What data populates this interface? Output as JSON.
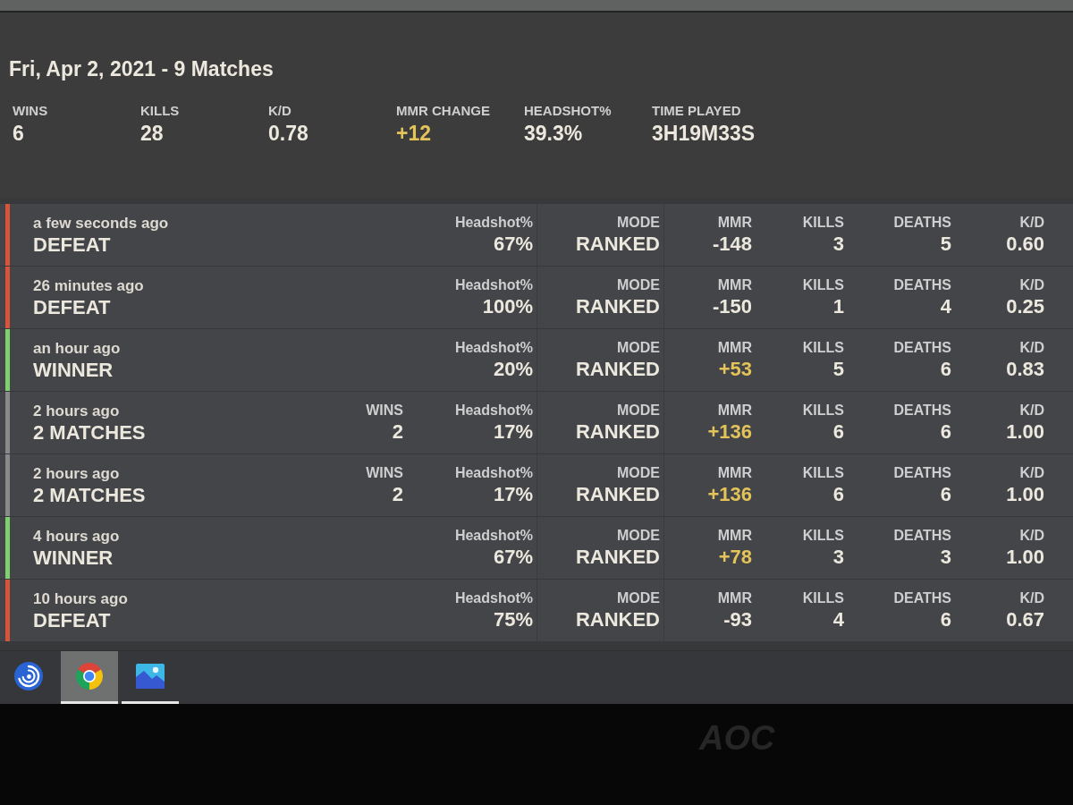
{
  "summary": {
    "title": "Fri, Apr 2, 2021 - 9 Matches",
    "stats": [
      {
        "label": "WINS",
        "value": "6",
        "highlight": false
      },
      {
        "label": "KILLS",
        "value": "28",
        "highlight": false
      },
      {
        "label": "K/D",
        "value": "0.78",
        "highlight": false
      },
      {
        "label": "MMR CHANGE",
        "value": "+12",
        "highlight": true
      },
      {
        "label": "HEADSHOT%",
        "value": "39.3%",
        "highlight": false
      },
      {
        "label": "TIME PLAYED",
        "value": "3H19M33S",
        "highlight": false
      }
    ]
  },
  "matches": [
    {
      "time": "a few seconds ago",
      "result": "DEFEAT",
      "color": "#d9533b",
      "stats": [
        {
          "label": "Headshot%",
          "value": "67%",
          "highlight": false
        },
        {
          "label": "MODE",
          "value": "RANKED",
          "highlight": false
        },
        {
          "label": "MMR",
          "value": "-148",
          "highlight": false
        },
        {
          "label": "KILLS",
          "value": "3",
          "highlight": false
        },
        {
          "label": "DEATHS",
          "value": "5",
          "highlight": false
        },
        {
          "label": "K/D",
          "value": "0.60",
          "highlight": false
        }
      ]
    },
    {
      "time": "26 minutes ago",
      "result": "DEFEAT",
      "color": "#d9533b",
      "stats": [
        {
          "label": "Headshot%",
          "value": "100%",
          "highlight": false
        },
        {
          "label": "MODE",
          "value": "RANKED",
          "highlight": false
        },
        {
          "label": "MMR",
          "value": "-150",
          "highlight": false
        },
        {
          "label": "KILLS",
          "value": "1",
          "highlight": false
        },
        {
          "label": "DEATHS",
          "value": "4",
          "highlight": false
        },
        {
          "label": "K/D",
          "value": "0.25",
          "highlight": false
        }
      ]
    },
    {
      "time": "an hour ago",
      "result": "WINNER",
      "color": "#7fd06e",
      "stats": [
        {
          "label": "Headshot%",
          "value": "20%",
          "highlight": false
        },
        {
          "label": "MODE",
          "value": "RANKED",
          "highlight": false
        },
        {
          "label": "MMR",
          "value": "+53",
          "highlight": true
        },
        {
          "label": "KILLS",
          "value": "5",
          "highlight": false
        },
        {
          "label": "DEATHS",
          "value": "6",
          "highlight": false
        },
        {
          "label": "K/D",
          "value": "0.83",
          "highlight": false
        }
      ]
    },
    {
      "time": "2 hours ago",
      "result": "2 MATCHES",
      "color": "#8a8a8a",
      "wins": {
        "label": "WINS",
        "value": "2"
      },
      "stats": [
        {
          "label": "Headshot%",
          "value": "17%",
          "highlight": false
        },
        {
          "label": "MODE",
          "value": "RANKED",
          "highlight": false
        },
        {
          "label": "MMR",
          "value": "+136",
          "highlight": true
        },
        {
          "label": "KILLS",
          "value": "6",
          "highlight": false
        },
        {
          "label": "DEATHS",
          "value": "6",
          "highlight": false
        },
        {
          "label": "K/D",
          "value": "1.00",
          "highlight": false
        }
      ]
    },
    {
      "time": "2 hours ago",
      "result": "2 MATCHES",
      "color": "#8a8a8a",
      "wins": {
        "label": "WINS",
        "value": "2"
      },
      "stats": [
        {
          "label": "Headshot%",
          "value": "17%",
          "highlight": false
        },
        {
          "label": "MODE",
          "value": "RANKED",
          "highlight": false
        },
        {
          "label": "MMR",
          "value": "+136",
          "highlight": true
        },
        {
          "label": "KILLS",
          "value": "6",
          "highlight": false
        },
        {
          "label": "DEATHS",
          "value": "6",
          "highlight": false
        },
        {
          "label": "K/D",
          "value": "1.00",
          "highlight": false
        }
      ]
    },
    {
      "time": "4 hours ago",
      "result": "WINNER",
      "color": "#7fd06e",
      "stats": [
        {
          "label": "Headshot%",
          "value": "67%",
          "highlight": false
        },
        {
          "label": "MODE",
          "value": "RANKED",
          "highlight": false
        },
        {
          "label": "MMR",
          "value": "+78",
          "highlight": true
        },
        {
          "label": "KILLS",
          "value": "3",
          "highlight": false
        },
        {
          "label": "DEATHS",
          "value": "3",
          "highlight": false
        },
        {
          "label": "K/D",
          "value": "1.00",
          "highlight": false
        }
      ]
    },
    {
      "time": "10 hours ago",
      "result": "DEFEAT",
      "color": "#d9533b",
      "stats": [
        {
          "label": "Headshot%",
          "value": "75%",
          "highlight": false
        },
        {
          "label": "MODE",
          "value": "RANKED",
          "highlight": false
        },
        {
          "label": "MMR",
          "value": "-93",
          "highlight": false
        },
        {
          "label": "KILLS",
          "value": "4",
          "highlight": false
        },
        {
          "label": "DEATHS",
          "value": "6",
          "highlight": false
        },
        {
          "label": "K/D",
          "value": "0.67",
          "highlight": false
        }
      ]
    }
  ],
  "taskbar": [
    {
      "kind": "swirl",
      "active": false,
      "running": false
    },
    {
      "kind": "browser",
      "active": true,
      "running": true
    },
    {
      "kind": "photos",
      "active": false,
      "running": true
    }
  ],
  "monitor": {
    "logo": "AOC"
  }
}
